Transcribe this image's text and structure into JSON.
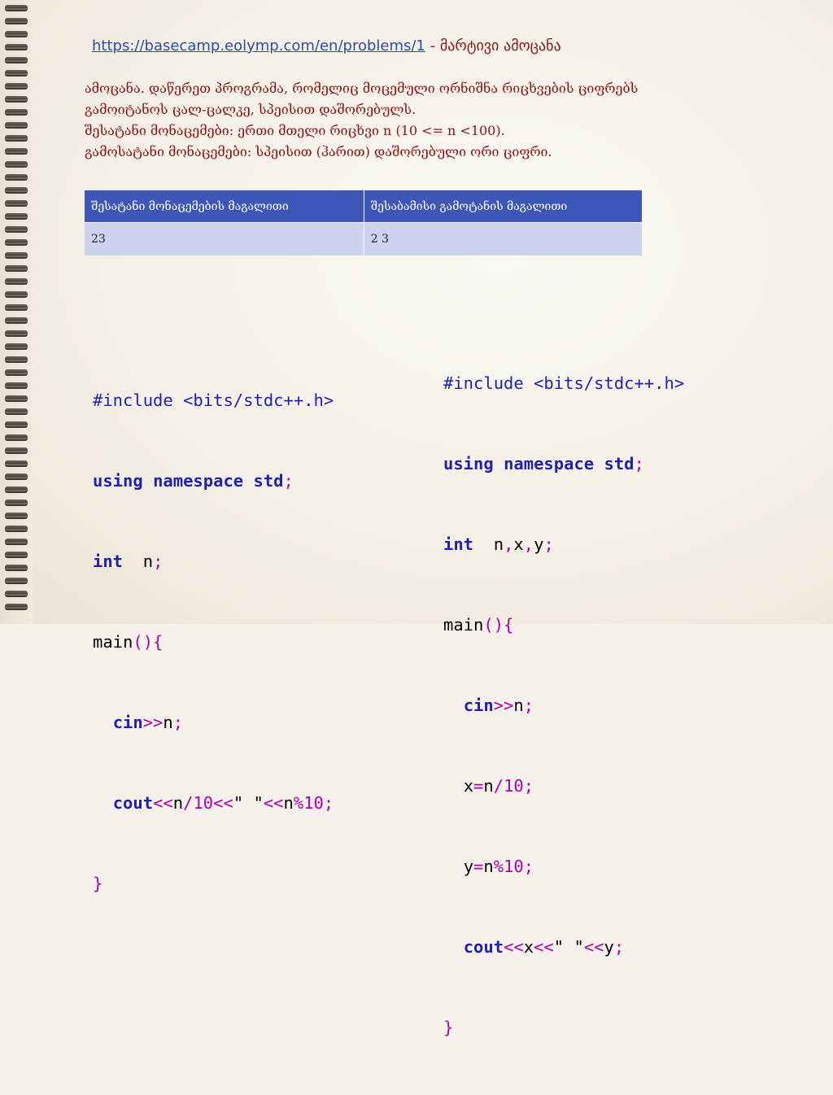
{
  "header": {
    "link_text": "https://basecamp.eolymp.com/en/problems/1",
    "title_suffix": " - მარტივი ამოცანა"
  },
  "description": {
    "lines": [
      "ამოცანა. დაწერეთ პროგრამა, რომელიც მოცემული ორნიშნა რიცხვების ციფრებს",
      "გამოიტანოს ცალ-ცალკე, სპეისით დაშორებულს.",
      "შესატანი მონაცემები: ერთი მთელი რიცხვი n (10 <= n <100).",
      "გამოსატანი მონაცემები: სპეისით (ჰარით) დაშორებული ორი ციფრი."
    ]
  },
  "io_table": {
    "headers": [
      "შესატანი მონაცემების მაგალითი",
      "შესაბამისი გამოტანის მაგალითი"
    ],
    "rows": [
      [
        "23",
        "2 3"
      ]
    ]
  },
  "code_left": {
    "include": "#include <bits/stdc++.h>",
    "using": "using",
    "namespace": "namespace",
    "std": "std",
    "semi": ";",
    "int_kw": "int",
    "int_vars": "  n",
    "main": "main",
    "paren_brace": "(){",
    "indent": "  ",
    "cin": "cin",
    "shr": ">>",
    "cin_var": "n",
    "cout": "cout",
    "shl": "<<",
    "n": "n",
    "div": "/",
    "ten": "10",
    "space_str": "\" \"",
    "mod": "%",
    "close": "}"
  },
  "code_right": {
    "include": "#include <bits/stdc++.h>",
    "using": "using",
    "namespace": "namespace",
    "std": "std",
    "semi": ";",
    "int_kw": "int",
    "int_vars_a": "  n",
    "comma": ",",
    "x": "x",
    "y": "y",
    "main": "main",
    "paren_brace": "(){",
    "indent": "  ",
    "cin": "cin",
    "shr": ">>",
    "n": "n",
    "eq": "=",
    "div": "/",
    "mod": "%",
    "ten": "10",
    "cout": "cout",
    "shl": "<<",
    "space_str": "\" \"",
    "close": "}"
  }
}
